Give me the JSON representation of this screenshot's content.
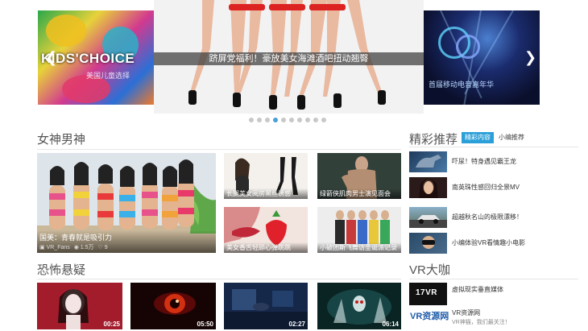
{
  "carousel": {
    "caption": "跻屏党福利！豪放美女海滩酒吧扭动翘臀",
    "left_slide": {
      "title": "KIDS'CHOICE",
      "subtitle": "美国儿童选择"
    },
    "right_slide": {
      "text": "首届移动电音嘉年华"
    },
    "dots_count": 10,
    "active_dot": 3
  },
  "section_goddess": {
    "title": "女神男神",
    "featured": {
      "caption": "国美：青春就是吸引力",
      "author": "VR_Fans",
      "views": "1.5万",
      "likes": "9"
    },
    "tiles": [
      {
        "caption": "长腿美女阅房黑丝诱惑"
      },
      {
        "caption": "绿箭侠肌肉男士演见面会"
      },
      {
        "caption": "美女香舌轻舔心弹跳跳"
      },
      {
        "caption": "小破团斯飞舞访圣诞派记录"
      }
    ]
  },
  "section_horror": {
    "title": "恐怖悬疑",
    "tiles": [
      {
        "duration": "00:25"
      },
      {
        "duration": "05:50"
      },
      {
        "duration": "02:27"
      },
      {
        "duration": "06:14"
      }
    ]
  },
  "section_recommend": {
    "title": "精彩推荐",
    "tab_active": "精彩内容",
    "tab_other": "小编推荐",
    "items": [
      {
        "title": "吓尿！特身遇见霸王龙"
      },
      {
        "title": "南英珠性感回归全景MV"
      },
      {
        "title": "超越秋名山的极限漂移！"
      },
      {
        "title": "小编体验VR看情趣小电影"
      }
    ]
  },
  "section_vr": {
    "title": "VR大咖",
    "items": [
      {
        "thumb_text": "17VR",
        "name": "虚拟现实垂直媒体",
        "desc": ""
      },
      {
        "thumb_text": "VR资源网",
        "name": "VR资源网",
        "desc": "VR神猫，我们最关注！"
      }
    ]
  },
  "colors": {
    "accent": "#2a9fd8",
    "active_dot": "#4a9fd8",
    "caption_bar": "#3c3c3c"
  }
}
